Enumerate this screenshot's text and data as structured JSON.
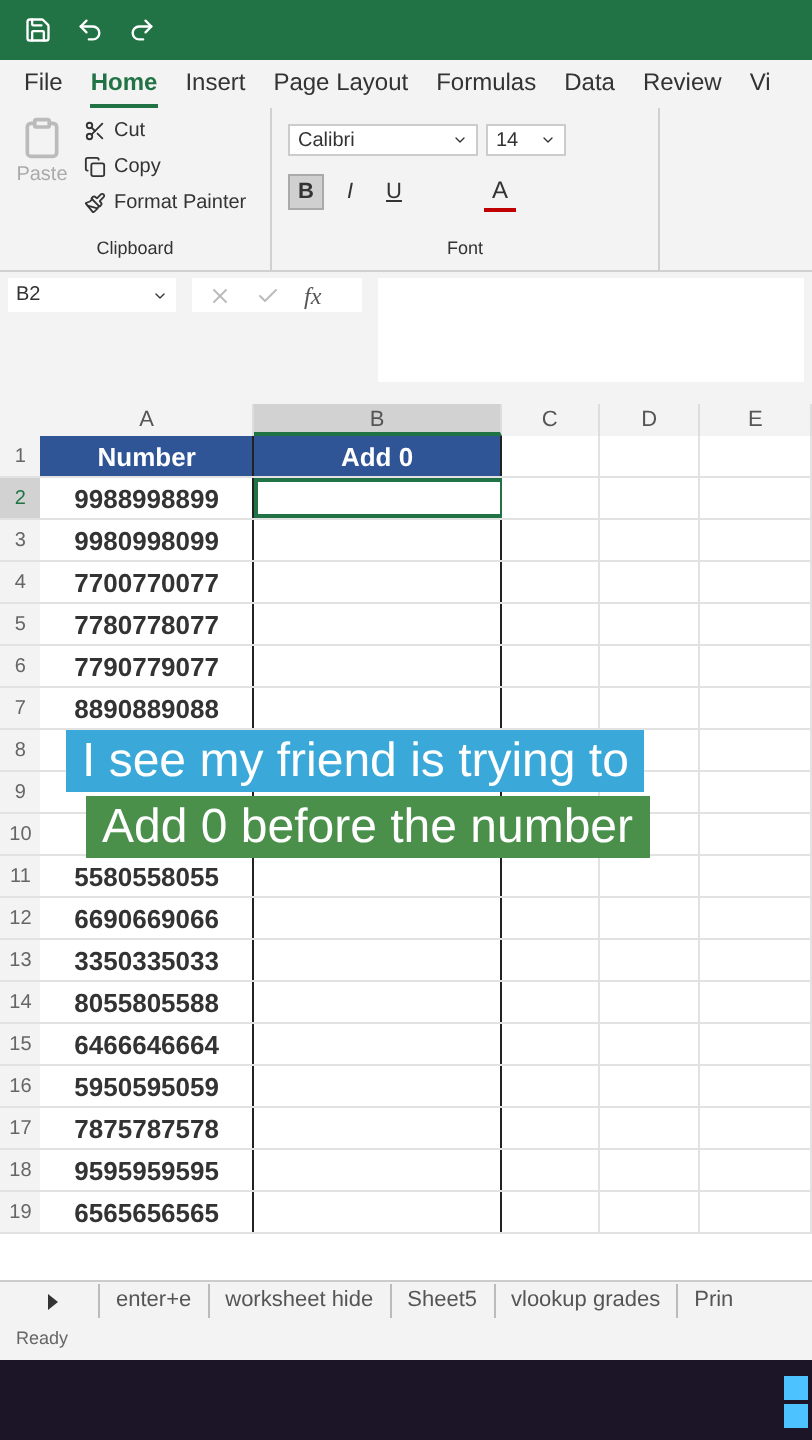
{
  "menu_tabs": [
    {
      "label": "File",
      "selected": false
    },
    {
      "label": "Home",
      "selected": true
    },
    {
      "label": "Insert",
      "selected": false
    },
    {
      "label": "Page Layout",
      "selected": false
    },
    {
      "label": "Formulas",
      "selected": false
    },
    {
      "label": "Data",
      "selected": false
    },
    {
      "label": "Review",
      "selected": false
    },
    {
      "label": "Vi",
      "selected": false
    }
  ],
  "clipboard": {
    "paste": "Paste",
    "cut": "Cut",
    "copy": "Copy",
    "format_painter": "Format Painter",
    "label": "Clipboard"
  },
  "font": {
    "family": "Calibri",
    "size": "14",
    "label": "Font",
    "font_color_letter": "A",
    "styles": [
      {
        "label": "B",
        "selected": true
      },
      {
        "label": "I",
        "selected": false
      },
      {
        "label": "U",
        "selected": false
      }
    ]
  },
  "name_box": "B2",
  "function_label": "fx",
  "columns": [
    {
      "label": "A",
      "selected": false
    },
    {
      "label": "B",
      "selected": true
    },
    {
      "label": "C",
      "selected": false
    },
    {
      "label": "D",
      "selected": false
    },
    {
      "label": "E",
      "selected": false
    }
  ],
  "rows": [
    {
      "number": "1",
      "kind": "header",
      "selected": false,
      "cells": [
        "Number",
        "Add 0"
      ]
    },
    {
      "number": "2",
      "kind": "data",
      "selected": true,
      "cells": [
        "9988998899"
      ]
    },
    {
      "number": "3",
      "kind": "data",
      "selected": false,
      "cells": [
        "9980998099"
      ]
    },
    {
      "number": "4",
      "kind": "data",
      "selected": false,
      "cells": [
        "7700770077"
      ]
    },
    {
      "number": "5",
      "kind": "data",
      "selected": false,
      "cells": [
        "7780778077"
      ]
    },
    {
      "number": "6",
      "kind": "data",
      "selected": false,
      "cells": [
        "7790779077"
      ]
    },
    {
      "number": "7",
      "kind": "data",
      "selected": false,
      "cells": [
        "8890889088"
      ]
    },
    {
      "number": "8",
      "kind": "data",
      "selected": false,
      "cells": []
    },
    {
      "number": "9",
      "kind": "data",
      "selected": false,
      "cells": []
    },
    {
      "number": "10",
      "kind": "data",
      "selected": false,
      "cells": []
    },
    {
      "number": "11",
      "kind": "data",
      "selected": false,
      "cells": [
        "5580558055"
      ]
    },
    {
      "number": "12",
      "kind": "data",
      "selected": false,
      "cells": [
        "6690669066"
      ]
    },
    {
      "number": "13",
      "kind": "data",
      "selected": false,
      "cells": [
        "3350335033"
      ]
    },
    {
      "number": "14",
      "kind": "data",
      "selected": false,
      "cells": [
        "8055805588"
      ]
    },
    {
      "number": "15",
      "kind": "data",
      "selected": false,
      "cells": [
        "6466646664"
      ]
    },
    {
      "number": "16",
      "kind": "data",
      "selected": false,
      "cells": [
        "5950595059"
      ]
    },
    {
      "number": "17",
      "kind": "data",
      "selected": false,
      "cells": [
        "7875787578"
      ]
    },
    {
      "number": "18",
      "kind": "data",
      "selected": false,
      "cells": [
        "9595959595"
      ]
    },
    {
      "number": "19",
      "kind": "data",
      "selected": false,
      "cells": [
        "6565656565"
      ]
    }
  ],
  "captions": [
    {
      "text": "I see my friend is trying to",
      "color": "#3aa8d8"
    },
    {
      "text": "Add 0 before the number",
      "color": "#4a8f4a"
    }
  ],
  "sheet_tabs": [
    {
      "label": "enter+e",
      "selected": false
    },
    {
      "label": "worksheet hide",
      "selected": false
    },
    {
      "label": "Sheet5",
      "selected": false
    },
    {
      "label": "vlookup grades",
      "selected": false
    },
    {
      "label": "Prin",
      "selected": false
    }
  ],
  "status": "Ready"
}
